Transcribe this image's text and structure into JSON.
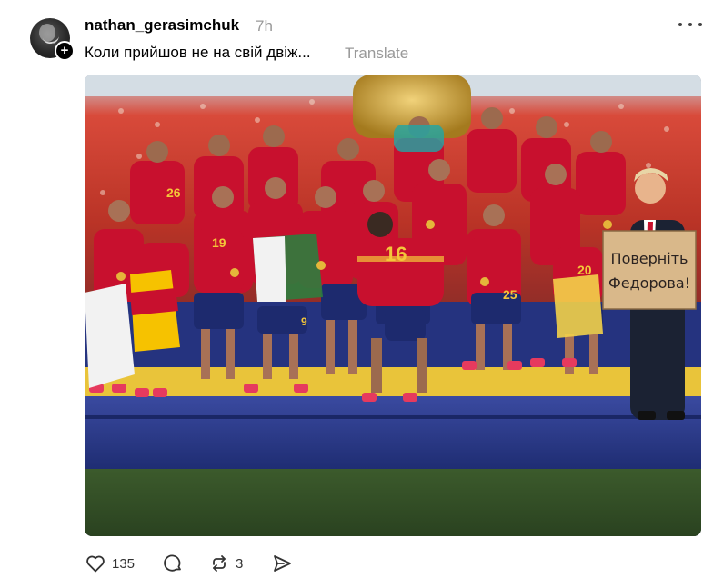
{
  "post": {
    "username": "nathan_gerasimchuk",
    "time": "7h",
    "caption": "Коли прийшов не на свій двіж...",
    "translate_label": "Translate",
    "avatar_icon": "avatar-icon",
    "follow_icon": "plus-icon"
  },
  "photo": {
    "sign_line1": "Поверніть",
    "sign_line2": "Федорова!",
    "jersey_numbers": [
      "26",
      "19",
      "16",
      "25",
      "20",
      "9"
    ]
  },
  "actions": {
    "like_count": "135",
    "repost_count": "3",
    "icons": [
      "heart-icon",
      "comment-icon",
      "repost-icon",
      "share-icon"
    ]
  },
  "colors": {
    "jersey_red": "#c8102e",
    "stage_blue": "#2b3a8a",
    "muted_text": "#999999"
  }
}
